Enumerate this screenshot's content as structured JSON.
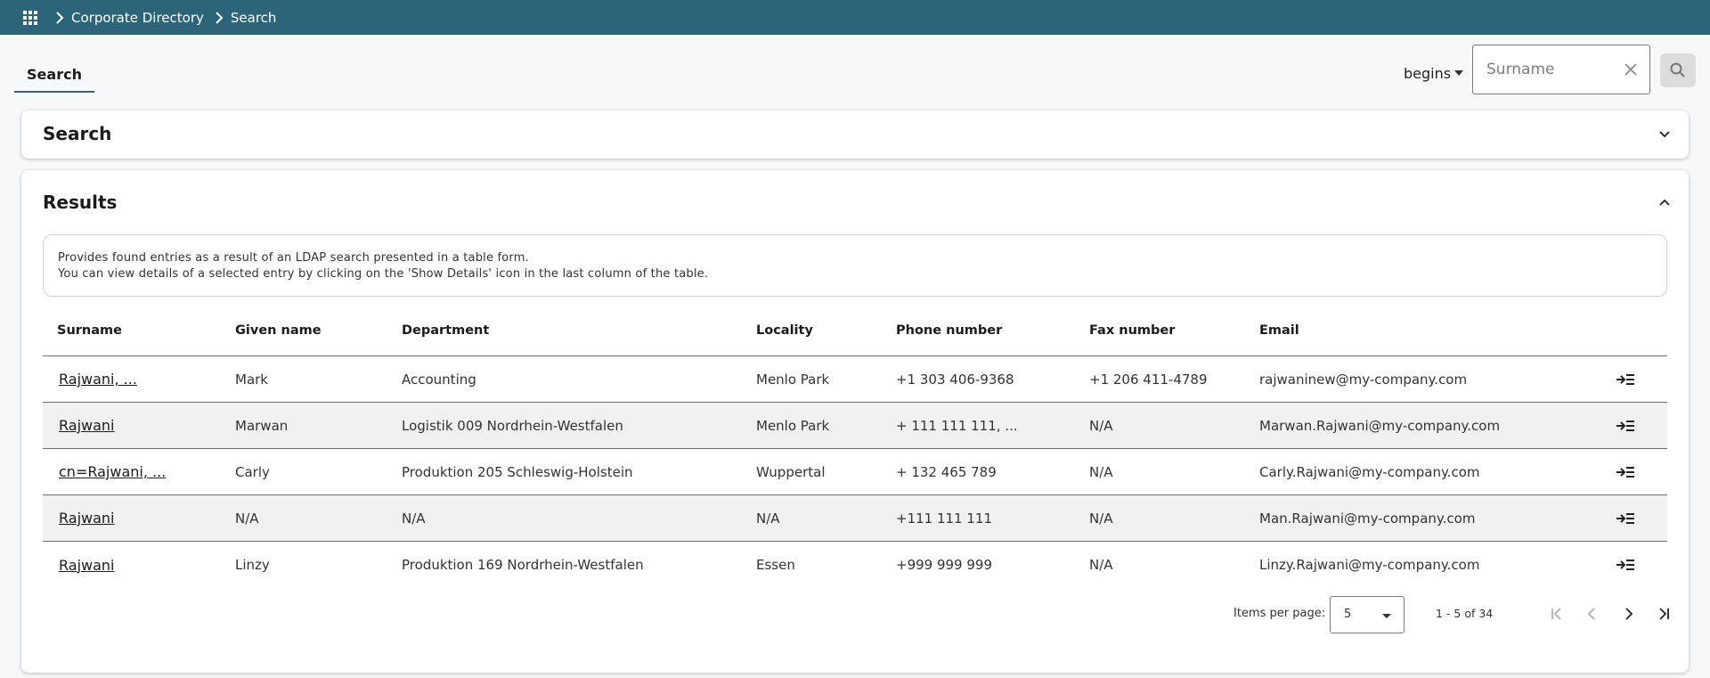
{
  "breadcrumb": {
    "items": [
      "Corporate Directory",
      "Search"
    ]
  },
  "tabs": [
    {
      "label": "Search",
      "active": true
    }
  ],
  "search": {
    "match_mode": "begins",
    "placeholder": "Surname",
    "value": ""
  },
  "panels": {
    "search_title": "Search",
    "results_title": "Results"
  },
  "results": {
    "info_line1": "Provides found entries as a result of an LDAP search presented in a table form.",
    "info_line2": "You can view details of a selected entry by clicking on the 'Show Details' icon in the last column of the table.",
    "columns": [
      "Surname",
      "Given name",
      "Department",
      "Locality",
      "Phone number",
      "Fax number",
      "Email"
    ],
    "rows": [
      {
        "surname": "Rajwani, ...",
        "given": "Mark",
        "department": "Accounting",
        "locality": "Menlo Park",
        "phone": "+1 303 406-9368",
        "fax": "+1 206 411-4789",
        "email": "rajwaninew@my-company.com"
      },
      {
        "surname": "Rajwani",
        "given": "Marwan",
        "department": "Logistik 009 Nordrhein-Westfalen",
        "locality": "Menlo Park",
        "phone": "+ 111 111 111, ...",
        "fax": "N/A",
        "email": "Marwan.Rajwani@my-company.com"
      },
      {
        "surname": "cn=Rajwani, ...",
        "given": "Carly",
        "department": "Produktion 205 Schleswig-Holstein",
        "locality": "Wuppertal",
        "phone": "+ 132 465 789",
        "fax": "N/A",
        "email": "Carly.Rajwani@my-company.com"
      },
      {
        "surname": "Rajwani",
        "given": "N/A",
        "department": "N/A",
        "locality": "N/A",
        "phone": "+111 111 111",
        "fax": "N/A",
        "email": "Man.Rajwani@my-company.com"
      },
      {
        "surname": "Rajwani",
        "given": "Linzy",
        "department": "Produktion 169 Nordrhein-Westfalen",
        "locality": "Essen",
        "phone": "+999 999 999",
        "fax": "N/A",
        "email": "Linzy.Rajwani@my-company.com"
      }
    ]
  },
  "paginator": {
    "items_per_page_label": "Items per page:",
    "page_size": "5",
    "range": "1 - 5 of 34"
  },
  "icons": {
    "apps": "apps-grid-icon",
    "separator": "chevron-right-icon",
    "clear": "close-icon",
    "search": "search-icon",
    "collapse": "chevron-down-icon",
    "expand": "chevron-up-icon",
    "details": "show-details-icon",
    "first": "first-page-icon",
    "prev": "prev-page-icon",
    "next": "next-page-icon",
    "last": "last-page-icon"
  },
  "colors": {
    "header": "#2c6479",
    "accent": "#2c6479",
    "row_shade": "#f0f0f0"
  }
}
